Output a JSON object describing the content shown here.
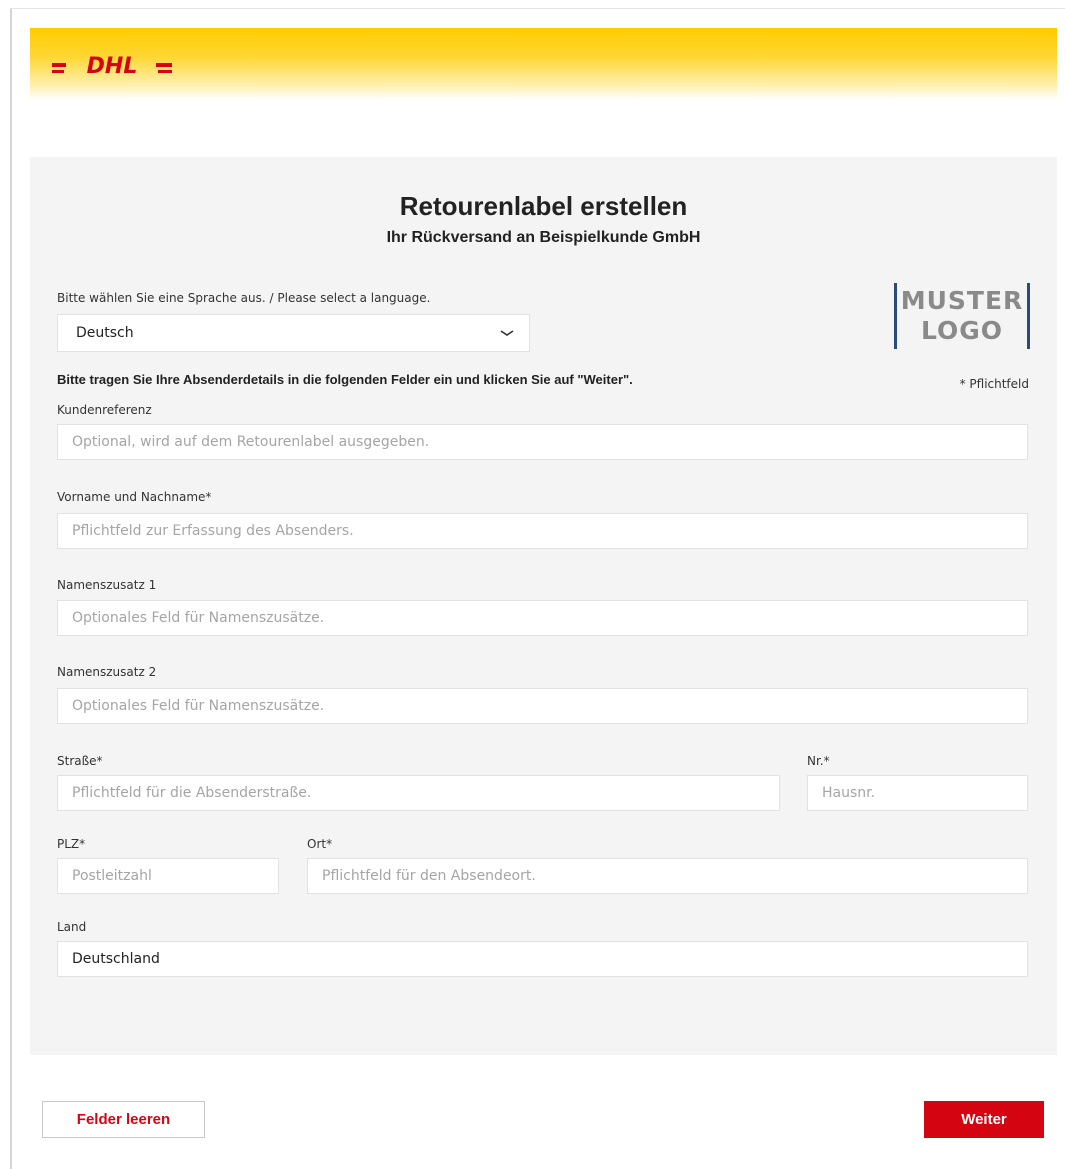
{
  "brand": {
    "logo_text": "DHL",
    "primary_color": "#ffcc00",
    "accent_color": "#d40511"
  },
  "page": {
    "title": "Retourenlabel erstellen",
    "subtitle": "Ihr Rückversand an Beispielkunde GmbH"
  },
  "language": {
    "label": "Bitte wählen Sie eine Sprache aus. / Please select a language.",
    "selected": "Deutsch",
    "icon": "chevron-down-icon"
  },
  "customer_logo": {
    "line1": "MUSTER",
    "line2": "LOGO"
  },
  "form": {
    "instructions": "Bitte tragen Sie Ihre Absenderdetails in die folgenden Felder ein und klicken Sie auf \"Weiter\".",
    "required_note": "* Pflichtfeld",
    "fields": {
      "customer_reference": {
        "label": "Kundenreferenz",
        "placeholder": "Optional, wird auf dem Retourenlabel ausgegeben."
      },
      "full_name": {
        "label": "Vorname und Nachname*",
        "placeholder": "Pflichtfeld zur Erfassung des Absenders."
      },
      "name_addition_1": {
        "label": "Namenszusatz 1",
        "placeholder": "Optionales Feld für Namenszusätze."
      },
      "name_addition_2": {
        "label": "Namenszusatz 2",
        "placeholder": "Optionales Feld für Namenszusätze."
      },
      "street": {
        "label": "Straße*",
        "placeholder": "Pflichtfeld für die Absenderstraße."
      },
      "house_number": {
        "label": "Nr.*",
        "placeholder": "Hausnr."
      },
      "postal_code": {
        "label": "PLZ*",
        "placeholder": "Postleitzahl"
      },
      "city": {
        "label": "Ort*",
        "placeholder": "Pflichtfeld für den Absendeort."
      },
      "country": {
        "label": "Land",
        "value": "Deutschland"
      }
    }
  },
  "actions": {
    "clear_label": "Felder leeren",
    "next_label": "Weiter"
  }
}
